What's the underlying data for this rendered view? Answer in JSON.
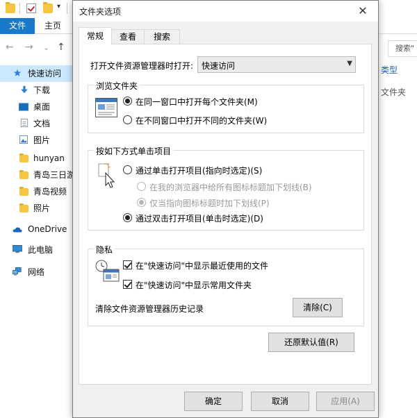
{
  "explorer": {
    "ribbon": {
      "file_label": "文件",
      "home_label": "主页"
    },
    "nav": {
      "back": "←",
      "forward": "→",
      "dropdown": "⌄",
      "up": "↑"
    },
    "search_placeholder": "搜索\"",
    "sidebar": [
      {
        "label": "快速访问",
        "icon": "star-icon",
        "active": true
      },
      {
        "label": "下载",
        "icon": "download-arrow-icon"
      },
      {
        "label": "桌面",
        "icon": "desktop-icon"
      },
      {
        "label": "文档",
        "icon": "document-icon"
      },
      {
        "label": "图片",
        "icon": "picture-icon"
      },
      {
        "label": "hunyan",
        "icon": "folder-icon"
      },
      {
        "label": "青岛三日游",
        "icon": "folder-icon"
      },
      {
        "label": "青岛视频",
        "icon": "folder-icon"
      },
      {
        "label": "照片",
        "icon": "folder-icon"
      },
      {
        "label": "OneDrive",
        "icon": "cloud-icon"
      },
      {
        "label": "此电脑",
        "icon": "computer-icon"
      },
      {
        "label": "网络",
        "icon": "network-icon"
      }
    ],
    "column_header": "类型",
    "column_value": "文件夹"
  },
  "dialog": {
    "title": "文件夹选项",
    "close": "✕",
    "tabs": [
      {
        "label": "常规",
        "active": true
      },
      {
        "label": "查看",
        "active": false
      },
      {
        "label": "搜索",
        "active": false
      }
    ],
    "open_explorer_label": "打开文件资源管理器时打开:",
    "open_explorer_value": "快速访问",
    "browse_group": {
      "title": "浏览文件夹",
      "options": [
        {
          "label": "在同一窗口中打开每个文件夹(M)",
          "checked": true
        },
        {
          "label": "在不同窗口中打开不同的文件夹(W)",
          "checked": false
        }
      ]
    },
    "click_group": {
      "title": "按如下方式单击项目",
      "single_click": {
        "label": "通过单击打开项目(指向时选定)(S)",
        "checked": false
      },
      "sub_options": [
        {
          "label": "在我的浏览器中给所有图标标题加下划线(B)",
          "checked": false
        },
        {
          "label": "仅当指向图标标题时加下划线(P)",
          "checked": true
        }
      ],
      "double_click": {
        "label": "通过双击打开项目(单击时选定)(D)",
        "checked": true
      }
    },
    "privacy_group": {
      "title": "隐私",
      "checks": [
        {
          "label": "在\"快速访问\"中显示最近使用的文件",
          "checked": true
        },
        {
          "label": "在\"快速访问\"中显示常用文件夹",
          "checked": true
        }
      ],
      "clear_label": "清除文件资源管理器历史记录",
      "clear_button": "清除(C)"
    },
    "restore_button": "还原默认值(R)",
    "buttons": {
      "ok": "确定",
      "cancel": "取消",
      "apply": "应用(A)"
    }
  },
  "colors": {
    "accent_blue": "#1979ca",
    "sidebar_active": "#cce8ff",
    "folder_yellow": "#f6c642"
  }
}
